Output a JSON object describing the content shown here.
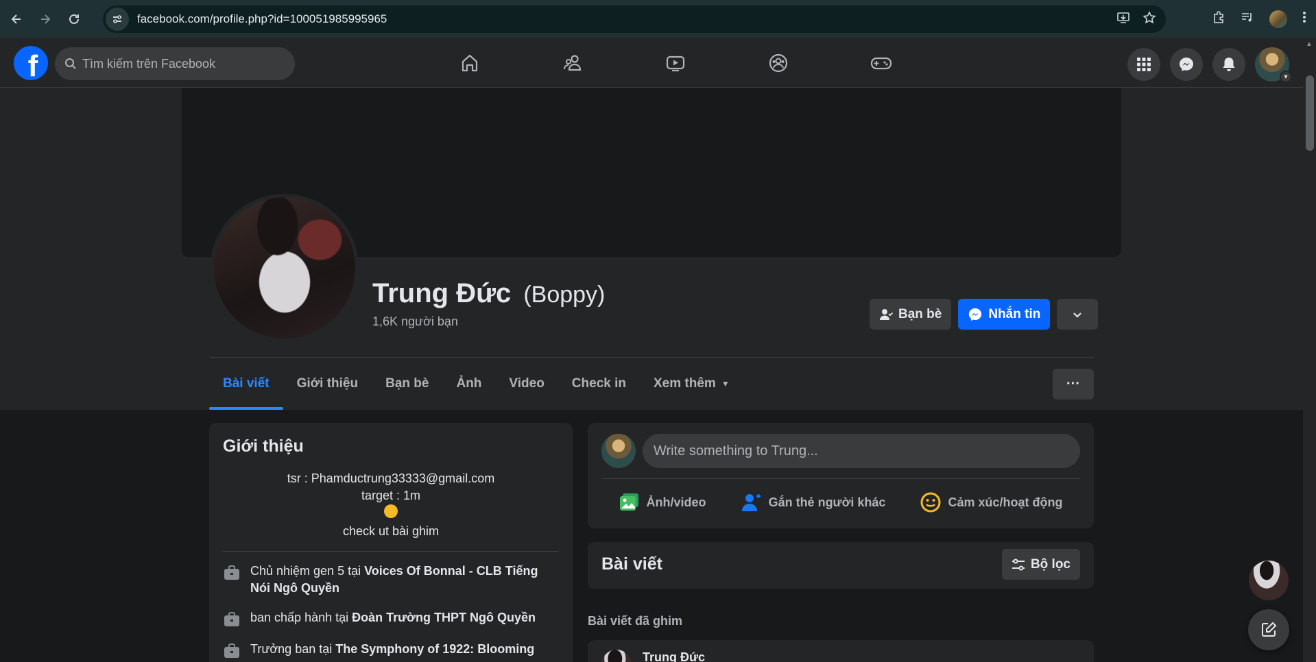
{
  "browser": {
    "url": "facebook.com/profile.php?id=100051985995965"
  },
  "topbar": {
    "logo": "f",
    "search_placeholder": "Tìm kiếm trên Facebook",
    "nav_icons": [
      "home-icon",
      "friends-icon",
      "watch-icon",
      "groups-icon",
      "gaming-icon"
    ],
    "right_icons": [
      "menu-grid-icon",
      "messenger-icon",
      "notifications-icon"
    ]
  },
  "profile": {
    "name": "Trung Đức",
    "nickname": "(Boppy)",
    "friend_count": "1,6K người bạn",
    "buttons": {
      "friends": "Bạn bè",
      "message": "Nhắn tin"
    },
    "tabs": [
      "Bài viết",
      "Giới thiệu",
      "Bạn bè",
      "Ảnh",
      "Video",
      "Check in",
      "Xem thêm"
    ],
    "active_tab": "Bài viết",
    "more_button": "···"
  },
  "intro": {
    "title": "Giới thiệu",
    "bio_lines": [
      "tsr : Phamductrung33333@gmail.com",
      "target : 1m",
      "check ut bài ghim"
    ],
    "work": [
      {
        "prefix": "Chủ nhiệm gen 5 tại ",
        "place": "Voices Of Bonnal - CLB Tiếng Nói Ngô Quyền"
      },
      {
        "prefix": "ban chấp hành tại ",
        "place": "Đoàn Trường THPT Ngô Quyền"
      },
      {
        "prefix": "Trưởng ban tại ",
        "place": "The Symphony of 1922: Blooming"
      }
    ]
  },
  "composer": {
    "placeholder": "Write something to Trung...",
    "options": [
      "Ảnh/video",
      "Gắn thẻ người khác",
      "Cảm xúc/hoạt động"
    ]
  },
  "posts": {
    "title": "Bài viết",
    "filter": "Bộ lọc",
    "pinned_label": "Bài viết đã ghim",
    "pinned_author": "Trung Đức"
  },
  "colors": {
    "accent": "#0866ff",
    "active_tab": "#2d88ff",
    "background": "#18191a",
    "card": "#242526"
  }
}
